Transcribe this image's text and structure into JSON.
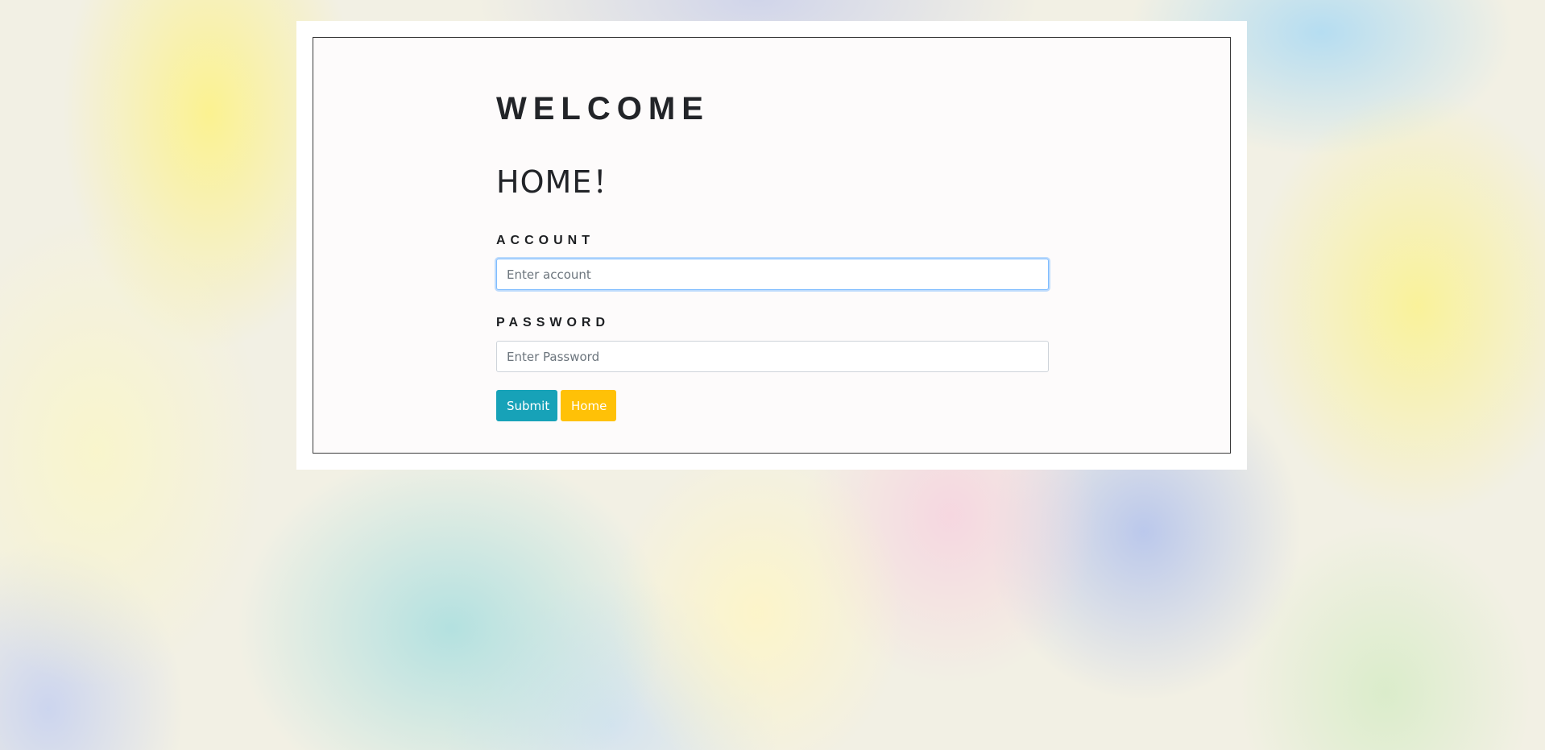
{
  "page": {
    "welcome": "WELCOME",
    "title": "HOME！"
  },
  "form": {
    "account_label": "ACCOUNT",
    "account_placeholder": "Enter account",
    "account_value": "",
    "password_label": "PASSWORD",
    "password_placeholder": "Enter Password",
    "password_value": "",
    "submit_label": "Submit",
    "home_label": "Home"
  },
  "colors": {
    "submit_button": "#17a2b8",
    "home_button": "#ffc107",
    "input_focus_border": "#80bdff",
    "text": "#222428"
  }
}
